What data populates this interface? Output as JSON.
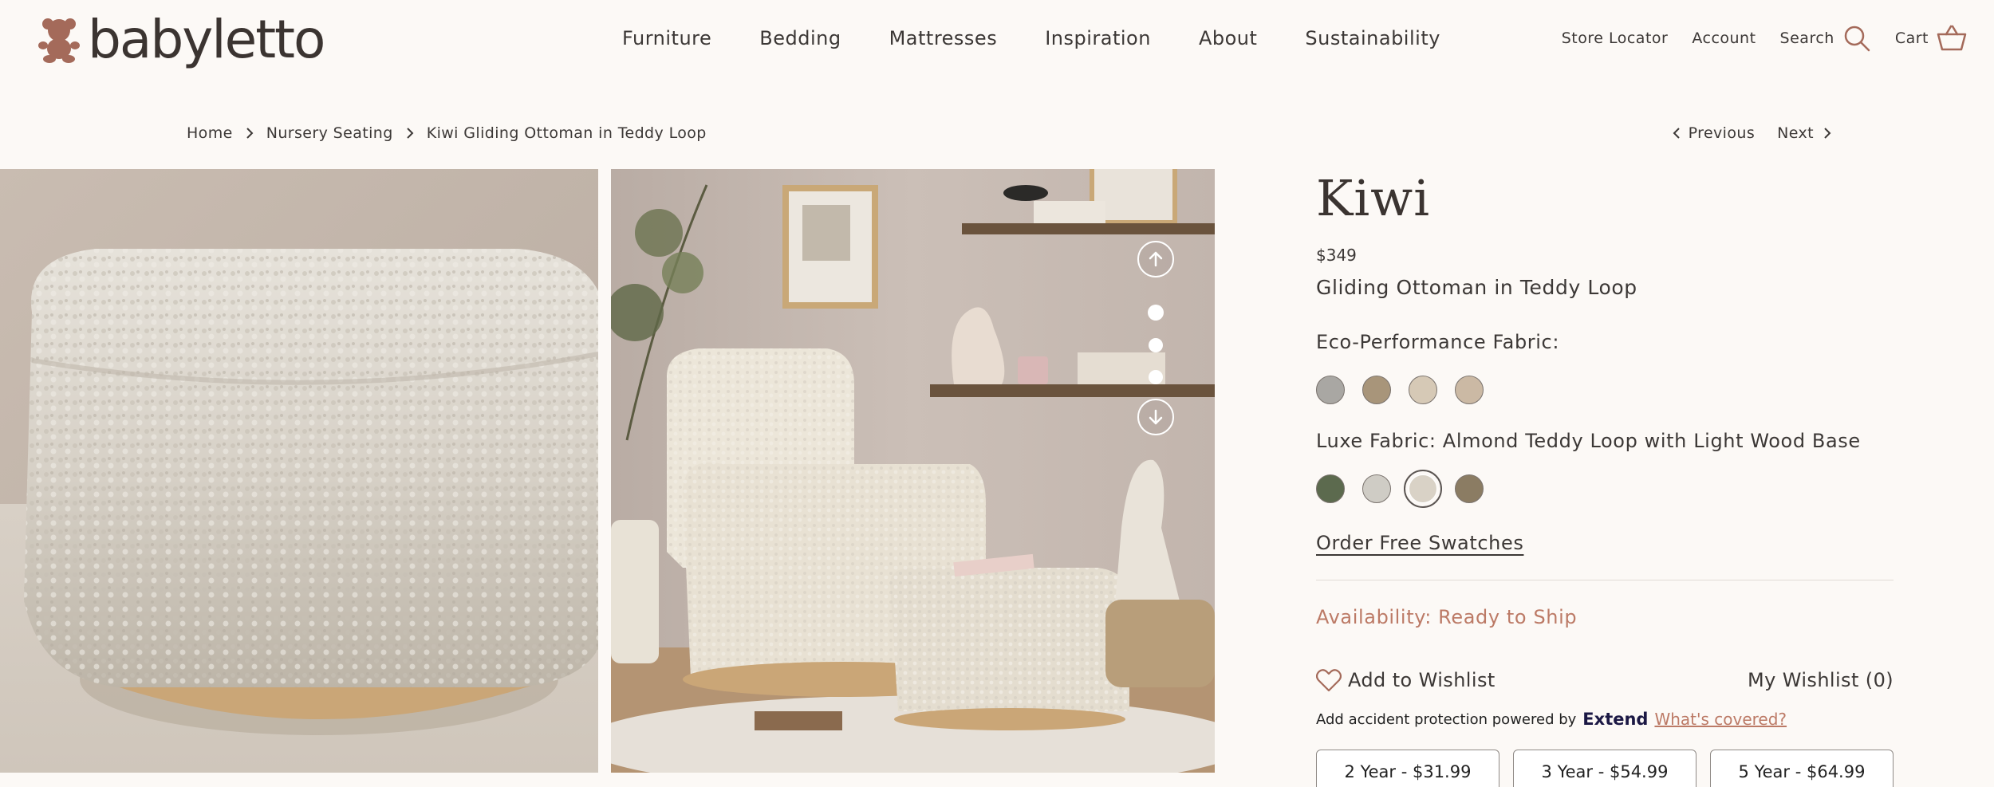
{
  "brand": {
    "name": "babyletto",
    "color": "#a46a5a"
  },
  "nav": {
    "items": [
      "Furniture",
      "Bedding",
      "Mattresses",
      "Inspiration",
      "About",
      "Sustainability"
    ]
  },
  "util": {
    "store_locator": "Store Locator",
    "account": "Account",
    "search": "Search",
    "cart": "Cart"
  },
  "breadcrumb": {
    "items": [
      "Home",
      "Nursery Seating",
      "Kiwi Gliding Ottoman in Teddy Loop"
    ]
  },
  "pager": {
    "previous": "Previous",
    "next": "Next"
  },
  "gallery": {
    "dots": 3,
    "active_dot": 1
  },
  "product": {
    "name": "Kiwi",
    "price": "$349",
    "subtitle": "Gliding Ottoman in Teddy Loop",
    "eco_label": "Eco-Performance Fabric:",
    "eco_swatches": [
      "#a9a7a3",
      "#a8957a",
      "#d6c9b6",
      "#cbb9a4"
    ],
    "luxe_label": "Luxe Fabric: Almond Teddy Loop with Light Wood Base",
    "luxe_swatches": [
      "#5c6a4e",
      "#cfccc5",
      "#d9d2c6",
      "#8b7c63"
    ],
    "luxe_selected_index": 2,
    "order_swatches": "Order Free Swatches",
    "availability": "Availability: Ready to Ship",
    "add_wishlist": "Add to Wishlist",
    "my_wishlist": "My Wishlist (0)"
  },
  "extend": {
    "text": "Add accident protection powered by",
    "brand": "Extend",
    "link": "What's covered?",
    "plans": [
      "2 Year - $31.99",
      "3 Year - $54.99",
      "5 Year - $64.99"
    ]
  }
}
